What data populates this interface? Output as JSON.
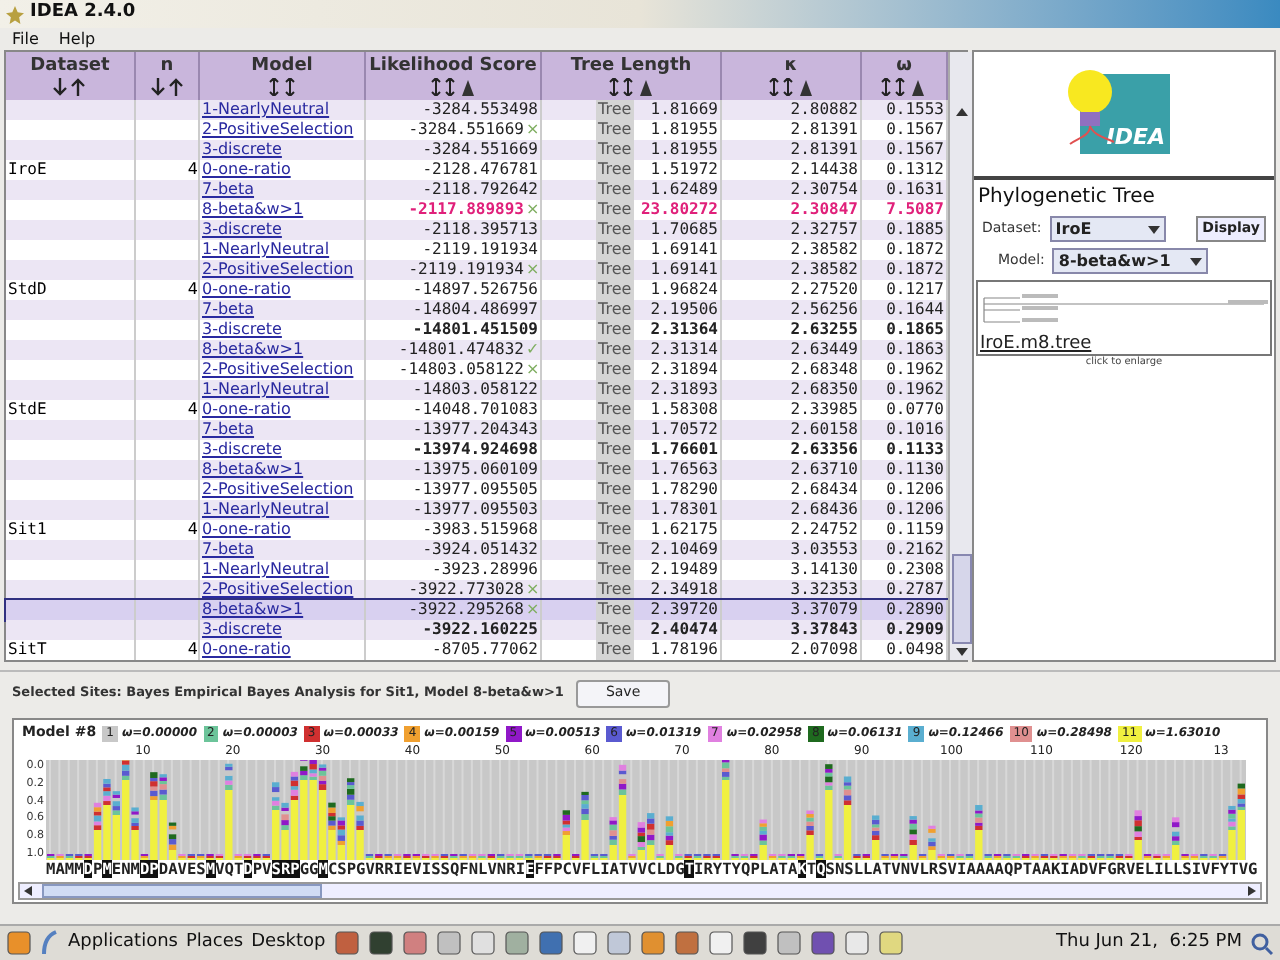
{
  "window": {
    "title": "IDEA 2.4.0"
  },
  "menu": [
    "File",
    "Help"
  ],
  "table": {
    "columns": [
      {
        "label": "Dataset",
        "kind": "arrows"
      },
      {
        "label": "n",
        "kind": "arrows"
      },
      {
        "label": "Model",
        "kind": "double"
      },
      {
        "label": "Likelihood Score",
        "kind": "filter"
      },
      {
        "label": "Tree Length",
        "kind": "filter"
      },
      {
        "label": "κ",
        "kind": "filter"
      },
      {
        "label": "ω",
        "kind": "filter"
      }
    ],
    "rows": [
      {
        "model": "1-NearlyNeutral",
        "score": "-3284.553498",
        "tree": "Tree",
        "length": "1.81669",
        "kappa": "2.80882",
        "omega": "0.1553",
        "bold": false,
        "highlighted": false,
        "selected": false
      },
      {
        "model": "2-PositiveSelection",
        "score": "-3284.551669",
        "flag": "×",
        "tree": "Tree",
        "length": "1.81955",
        "kappa": "2.81391",
        "omega": "0.1567",
        "bold": false,
        "highlighted": false,
        "selected": false
      },
      {
        "model": "3-discrete",
        "score": "-3284.551669",
        "tree": "Tree",
        "length": "1.81955",
        "kappa": "2.81391",
        "omega": "0.1567",
        "bold": false,
        "highlighted": false,
        "selected": false
      },
      {
        "dataset": "IroE",
        "n": "4",
        "model": "0-one-ratio",
        "score": "-2128.476781",
        "tree": "Tree",
        "length": "1.51972",
        "kappa": "2.14438",
        "omega": "0.1312",
        "bold": false,
        "highlighted": false,
        "selected": false
      },
      {
        "model": "7-beta",
        "score": "-2118.792642",
        "tree": "Tree",
        "length": "1.62489",
        "kappa": "2.30754",
        "omega": "0.1631",
        "bold": false,
        "highlighted": false,
        "selected": false
      },
      {
        "model": "8-beta&w>1",
        "score": "-2117.889893",
        "flag": "×",
        "tree": "Tree",
        "length": "23.80272",
        "kappa": "2.30847",
        "omega": "7.5087",
        "bold": true,
        "highlighted": true,
        "selected": false
      },
      {
        "model": "3-discrete",
        "score": "-2118.395713",
        "tree": "Tree",
        "length": "1.70685",
        "kappa": "2.32757",
        "omega": "0.1885",
        "bold": false,
        "highlighted": false,
        "selected": false
      },
      {
        "model": "1-NearlyNeutral",
        "score": "-2119.191934",
        "tree": "Tree",
        "length": "1.69141",
        "kappa": "2.38582",
        "omega": "0.1872",
        "bold": false,
        "highlighted": false,
        "selected": false
      },
      {
        "model": "2-PositiveSelection",
        "score": "-2119.191934",
        "flag": "×",
        "tree": "Tree",
        "length": "1.69141",
        "kappa": "2.38582",
        "omega": "0.1872",
        "bold": false,
        "highlighted": false,
        "selected": false
      },
      {
        "dataset": "StdD",
        "n": "4",
        "model": "0-one-ratio",
        "score": "-14897.526756",
        "tree": "Tree",
        "length": "1.96824",
        "kappa": "2.27520",
        "omega": "0.1217",
        "bold": false,
        "highlighted": false,
        "selected": false
      },
      {
        "model": "7-beta",
        "score": "-14804.486997",
        "tree": "Tree",
        "length": "2.19506",
        "kappa": "2.56256",
        "omega": "0.1644",
        "bold": false,
        "highlighted": false,
        "selected": false
      },
      {
        "model": "3-discrete",
        "score": "-14801.451509",
        "tree": "Tree",
        "length": "2.31364",
        "kappa": "2.63255",
        "omega": "0.1865",
        "bold": true,
        "highlighted": false,
        "selected": false
      },
      {
        "model": "8-beta&w>1",
        "score": "-14801.474832",
        "flag": "✓",
        "tree": "Tree",
        "length": "2.31314",
        "kappa": "2.63449",
        "omega": "0.1863",
        "bold": false,
        "highlighted": false,
        "selected": false
      },
      {
        "model": "2-PositiveSelection",
        "score": "-14803.058122",
        "flag": "×",
        "tree": "Tree",
        "length": "2.31894",
        "kappa": "2.68348",
        "omega": "0.1962",
        "bold": false,
        "highlighted": false,
        "selected": false
      },
      {
        "model": "1-NearlyNeutral",
        "score": "-14803.058122",
        "tree": "Tree",
        "length": "2.31893",
        "kappa": "2.68350",
        "omega": "0.1962",
        "bold": false,
        "highlighted": false,
        "selected": false
      },
      {
        "dataset": "StdE",
        "n": "4",
        "model": "0-one-ratio",
        "score": "-14048.701083",
        "tree": "Tree",
        "length": "1.58308",
        "kappa": "2.33985",
        "omega": "0.0770",
        "bold": false,
        "highlighted": false,
        "selected": false
      },
      {
        "model": "7-beta",
        "score": "-13977.204343",
        "tree": "Tree",
        "length": "1.70572",
        "kappa": "2.60158",
        "omega": "0.1016",
        "bold": false,
        "highlighted": false,
        "selected": false
      },
      {
        "model": "3-discrete",
        "score": "-13974.924698",
        "tree": "Tree",
        "length": "1.76601",
        "kappa": "2.63356",
        "omega": "0.1133",
        "bold": true,
        "highlighted": false,
        "selected": false
      },
      {
        "model": "8-beta&w>1",
        "score": "-13975.060109",
        "tree": "Tree",
        "length": "1.76563",
        "kappa": "2.63710",
        "omega": "0.1130",
        "bold": false,
        "highlighted": false,
        "selected": false
      },
      {
        "model": "2-PositiveSelection",
        "score": "-13977.095505",
        "tree": "Tree",
        "length": "1.78290",
        "kappa": "2.68434",
        "omega": "0.1206",
        "bold": false,
        "highlighted": false,
        "selected": false
      },
      {
        "model": "1-NearlyNeutral",
        "score": "-13977.095503",
        "tree": "Tree",
        "length": "1.78301",
        "kappa": "2.68436",
        "omega": "0.1206",
        "bold": false,
        "highlighted": false,
        "selected": false
      },
      {
        "dataset": "Sit1",
        "n": "4",
        "model": "0-one-ratio",
        "score": "-3983.515968",
        "tree": "Tree",
        "length": "1.62175",
        "kappa": "2.24752",
        "omega": "0.1159",
        "bold": false,
        "highlighted": false,
        "selected": false
      },
      {
        "model": "7-beta",
        "score": "-3924.051432",
        "tree": "Tree",
        "length": "2.10469",
        "kappa": "3.03553",
        "omega": "0.2162",
        "bold": false,
        "highlighted": false,
        "selected": false
      },
      {
        "model": "1-NearlyNeutral",
        "score": "-3923.28996",
        "tree": "Tree",
        "length": "2.19489",
        "kappa": "3.14130",
        "omega": "0.2308",
        "bold": false,
        "highlighted": false,
        "selected": false
      },
      {
        "model": "2-PositiveSelection",
        "score": "-3922.773028",
        "flag": "×",
        "tree": "Tree",
        "length": "2.34918",
        "kappa": "3.32353",
        "omega": "0.2787",
        "bold": false,
        "highlighted": false,
        "selected": false
      },
      {
        "model": "8-beta&w>1",
        "score": "-3922.295268",
        "flag": "×",
        "tree": "Tree",
        "length": "2.39720",
        "kappa": "3.37079",
        "omega": "0.2890",
        "bold": false,
        "highlighted": false,
        "selected": true
      },
      {
        "model": "3-discrete",
        "score": "-3922.160225",
        "tree": "Tree",
        "length": "2.40474",
        "kappa": "3.37843",
        "omega": "0.2909",
        "bold": true,
        "highlighted": false,
        "selected": false
      },
      {
        "dataset": "SitT",
        "n": "4",
        "model": "0-one-ratio",
        "score": "-8705.77062",
        "tree": "Tree",
        "length": "1.78196",
        "kappa": "2.07098",
        "omega": "0.0498",
        "bold": false,
        "highlighted": false,
        "selected": false
      }
    ]
  },
  "side_panel": {
    "logo_text": "IDEA",
    "title": "Phylogenetic Tree",
    "dataset_label": "Dataset:",
    "dataset_value": "IroE",
    "display_button": "Display",
    "model_label": "Model:",
    "model_value": "8-beta&w>1",
    "tree_file": "IroE.m8.tree",
    "tree_hint": "click to enlarge"
  },
  "selected_sites": {
    "label": "Selected Sites:  Bayes Empirical Bayes Analysis for Sit1, Model 8-beta&w>1",
    "save_button": "Save"
  },
  "site_chart": {
    "title": "Model #8",
    "legend": [
      {
        "index": "1",
        "label": "ω=0.00000",
        "color": "#c8c8c8"
      },
      {
        "index": "2",
        "label": "ω=0.00003",
        "color": "#6cc49a"
      },
      {
        "index": "3",
        "label": "ω=0.00033",
        "color": "#d03030"
      },
      {
        "index": "4",
        "label": "ω=0.00159",
        "color": "#f0a030"
      },
      {
        "index": "5",
        "label": "ω=0.00513",
        "color": "#9018c8"
      },
      {
        "index": "6",
        "label": "ω=0.01319",
        "color": "#5a5ad0"
      },
      {
        "index": "7",
        "label": "ω=0.02958",
        "color": "#e080e0"
      },
      {
        "index": "8",
        "label": "ω=0.06131",
        "color": "#1f6a1f"
      },
      {
        "index": "9",
        "label": "ω=0.12466",
        "color": "#5aaed0"
      },
      {
        "index": "10",
        "label": "ω=0.28498",
        "color": "#e09090"
      },
      {
        "index": "11",
        "label": "ω=1.63010",
        "color": "#f0f040"
      }
    ],
    "x_tick_labels": [
      "10",
      "20",
      "30",
      "40",
      "50",
      "60",
      "70",
      "80",
      "90",
      "100",
      "110",
      "120",
      "13"
    ],
    "y_tick_labels": [
      "0.0",
      "0.2",
      "0.4",
      "0.6",
      "0.8",
      "1.0"
    ],
    "sequence": [
      {
        "text": "MAMM",
        "highlighted": false
      },
      {
        "text": "D",
        "highlighted": true
      },
      {
        "text": "P",
        "highlighted": false
      },
      {
        "text": "M",
        "highlighted": true
      },
      {
        "text": "ENM",
        "highlighted": false
      },
      {
        "text": "DP",
        "highlighted": true
      },
      {
        "text": "DAVES",
        "highlighted": false
      },
      {
        "text": "M",
        "highlighted": true
      },
      {
        "text": "VQT",
        "highlighted": false
      },
      {
        "text": "D",
        "highlighted": true
      },
      {
        "text": "PV",
        "highlighted": false
      },
      {
        "text": "SRP",
        "highlighted": true
      },
      {
        "text": "GG",
        "highlighted": false
      },
      {
        "text": "M",
        "highlighted": true
      },
      {
        "text": "CSPGVRRIEVISSQFNLVNRI",
        "highlighted": false
      },
      {
        "text": "E",
        "highlighted": true
      },
      {
        "text": "FFPCVFLIATVVCLDG",
        "highlighted": false
      },
      {
        "text": "T",
        "highlighted": true
      },
      {
        "text": "IRYTYQPLATA",
        "highlighted": false
      },
      {
        "text": "K",
        "highlighted": true
      },
      {
        "text": "T",
        "highlighted": false
      },
      {
        "text": "Q",
        "highlighted": true
      },
      {
        "text": "SNSLLATVNVLRSVIAAAAQPTAAKIADVFGRVELILLSIVFYTVG",
        "highlighted": false
      }
    ]
  },
  "taskbar": {
    "menus": [
      "Applications",
      "Places",
      "Desktop"
    ],
    "clock": "Thu Jun 21,  6:25 PM"
  }
}
